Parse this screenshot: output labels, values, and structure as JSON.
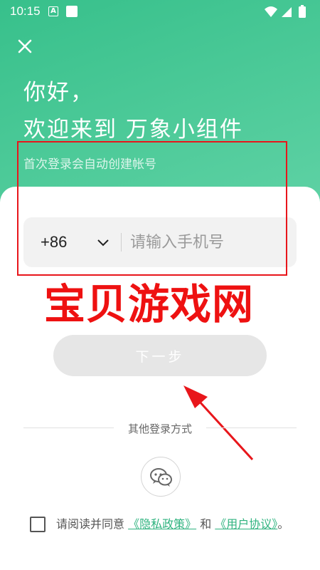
{
  "status_bar": {
    "time": "10:15",
    "notif_a": "A"
  },
  "header": {
    "greeting_line1": "你好，",
    "greeting_line2": "欢迎来到 万象小组件",
    "subtitle": "首次登录会自动创建帐号"
  },
  "login_form": {
    "country_code": "+86",
    "phone_placeholder": "请输入手机号",
    "next_button_label": "下一步"
  },
  "watermark_text": "宝贝游戏网",
  "other_login": {
    "label": "其他登录方式",
    "wechat_icon": "wechat-icon"
  },
  "agreement": {
    "prefix": "请阅读并同意 ",
    "privacy_link": "《隐私政策》",
    "and": " 和 ",
    "terms_link": "《用户协议》",
    "suffix": "。"
  },
  "colors": {
    "brand_green": "#3cc28f",
    "annotation_red": "#e8161b",
    "disabled_button": "#e6e6e6"
  }
}
